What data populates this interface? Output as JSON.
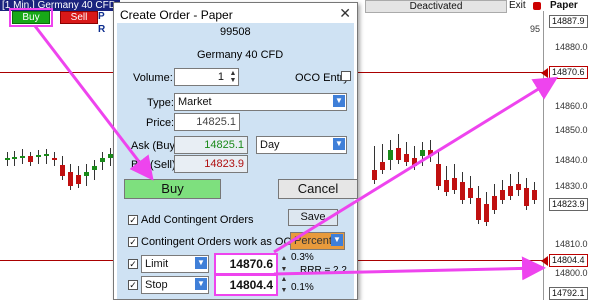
{
  "chart": {
    "title": "[1 Min.] Germany 40 CFD",
    "deactivated_label": "Deactivated",
    "exit_label": "Exit",
    "paper_label": "Paper",
    "buy_label": "Buy",
    "sell_label": "Sell",
    "axis_ticks": [
      "14880.0",
      "14860.0",
      "14850.0",
      "14840.0",
      "14830.0",
      "14810.0",
      "14800.0"
    ],
    "price_boxes": {
      "top": "14887.9",
      "limit": "14870.6",
      "last": "14823.9",
      "stop": "14804.4",
      "bottom": "14792.1"
    },
    "fragments": {
      "p": "P",
      "r": "R",
      "n95": "95"
    }
  },
  "dialog": {
    "title": "Create Order - Paper",
    "close": "✕",
    "account": "99508",
    "instrument": "Germany 40 CFD",
    "volume_label": "Volume:",
    "volume_value": "1",
    "oco_entry_label": "OCO Entry",
    "type_label": "Type:",
    "type_value": "Market",
    "price_label": "Price:",
    "price_value": "14825.1",
    "ask_label": "Ask (Buy):",
    "ask_value": "14825.1",
    "validity_value": "Day",
    "bid_label": "Bid (Sell):",
    "bid_value": "14823.9",
    "buy_button": "Buy",
    "cancel_button": "Cancel",
    "add_contingent_label": "Add Contingent Orders",
    "save_button": "Save",
    "oco_contingent_label": "Contingent Orders work as OCO",
    "percent_value": "Percent",
    "limit_type": "Limit",
    "limit_value": "14870.6",
    "limit_pct": "0.3%",
    "rrr": "RRR = 2.2",
    "stop_type": "Stop",
    "stop_value": "14804.4",
    "stop_pct": "0.1%",
    "check_mark": "✓"
  },
  "colors": {
    "dialog_bg": "#cfe2f3",
    "buy_green": "#7ee07e",
    "ask_green": "#1a8a1a",
    "bid_red": "#b01010",
    "highlight_magenta": "#ee44ee",
    "candle_up": "#1a8a1a",
    "candle_down": "#c01010"
  }
}
